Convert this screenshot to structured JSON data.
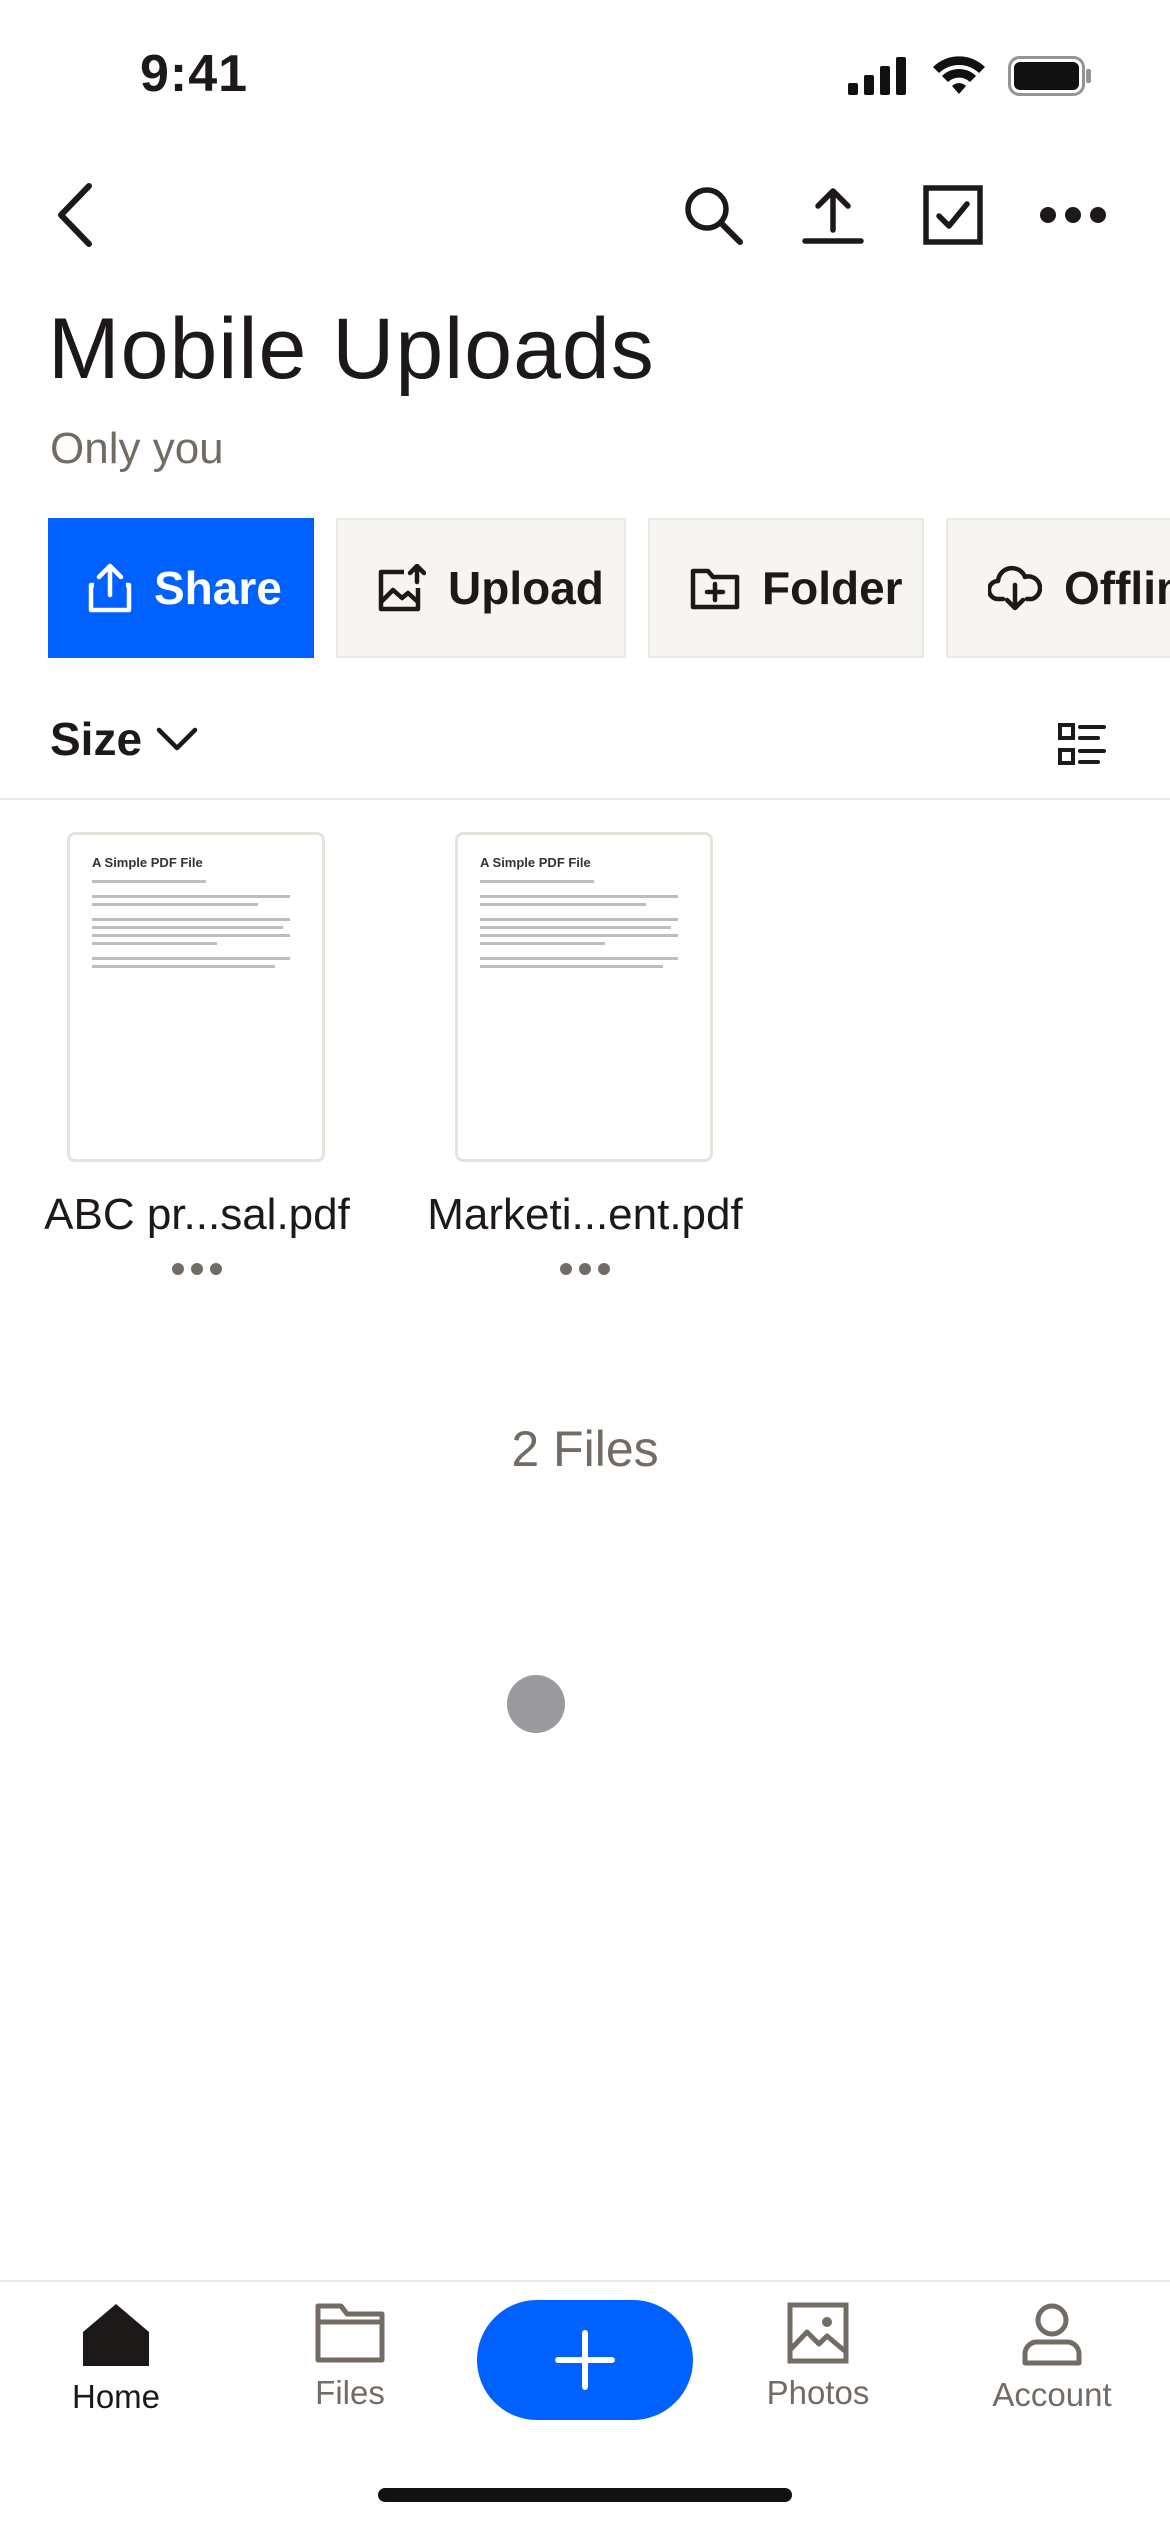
{
  "status_bar": {
    "time": "9:41"
  },
  "header": {
    "title": "Mobile Uploads",
    "subtitle": "Only you"
  },
  "actions": [
    {
      "label": "Share",
      "icon": "share-icon",
      "primary": true
    },
    {
      "label": "Upload",
      "icon": "image-upload-icon",
      "primary": false
    },
    {
      "label": "Folder",
      "icon": "folder-plus-icon",
      "primary": false
    },
    {
      "label": "Offlin",
      "icon": "cloud-download-icon",
      "primary": false
    }
  ],
  "sort": {
    "label": "Size"
  },
  "files": [
    {
      "name": "ABC pr...sal.pdf",
      "thumb_title": "A Simple PDF File"
    },
    {
      "name": "Marketi...ent.pdf",
      "thumb_title": "A Simple PDF File"
    }
  ],
  "files_count": "2 Files",
  "tabs": [
    {
      "label": "Home",
      "icon": "home-icon",
      "active": true
    },
    {
      "label": "Files",
      "icon": "folder-icon",
      "active": false
    },
    {
      "label": "Photos",
      "icon": "photo-icon",
      "active": false
    },
    {
      "label": "Account",
      "icon": "person-icon",
      "active": false
    }
  ],
  "colors": {
    "accent": "#0061fe",
    "secondary_button": "#f7f5f2",
    "text": "#1e1919",
    "muted_text": "#736c64"
  }
}
